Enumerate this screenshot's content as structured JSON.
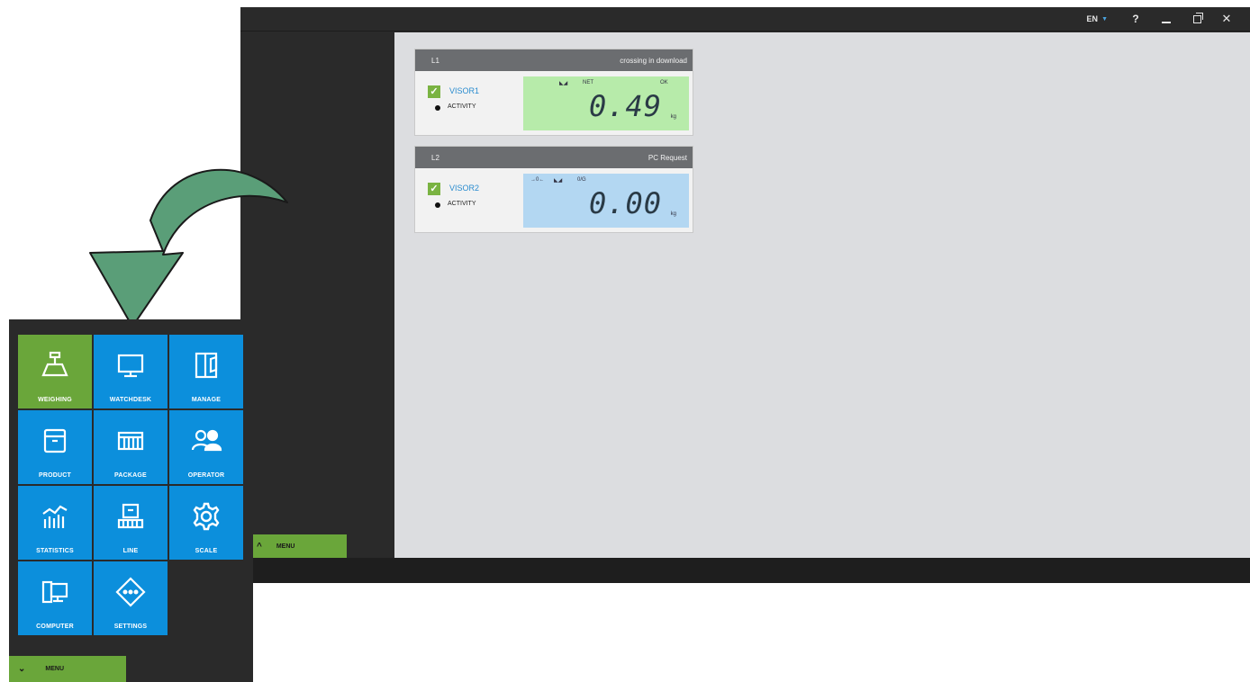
{
  "titlebar": {
    "language": "EN",
    "help": "?",
    "close": "✕"
  },
  "lines": [
    {
      "id": "L1",
      "status": "crossing in download",
      "visor": "VISOR1",
      "activity": "ACTIVITY",
      "value": "0.49",
      "unit": "kg",
      "flags": [
        "◣◢",
        "NET",
        "OK"
      ],
      "display_color": "#b7ebaa"
    },
    {
      "id": "L2",
      "status": "PC Request",
      "visor": "VISOR2",
      "activity": "ACTIVITY",
      "value": "0.00",
      "unit": "kg",
      "flags": [
        "→0←",
        "◣◢",
        "0/G"
      ],
      "display_color": "#b3d7f2"
    }
  ],
  "menu_button": {
    "label": "MENU"
  },
  "menu": {
    "tiles": [
      {
        "label": "WEIGHING",
        "icon": "scale-icon",
        "active": true
      },
      {
        "label": "WATCHDESK",
        "icon": "monitor-icon"
      },
      {
        "label": "MANAGE",
        "icon": "folder-icon"
      },
      {
        "label": "PRODUCT",
        "icon": "box-icon"
      },
      {
        "label": "PACKAGE",
        "icon": "package-icon"
      },
      {
        "label": "OPERATOR",
        "icon": "operators-icon"
      },
      {
        "label": "STATISTICS",
        "icon": "statistics-icon"
      },
      {
        "label": "LINE",
        "icon": "line-icon"
      },
      {
        "label": "SCALE",
        "icon": "gear-icon"
      },
      {
        "label": "COMPUTER",
        "icon": "computer-icon"
      },
      {
        "label": "SETTINGS",
        "icon": "settings-icon"
      }
    ],
    "toggle_label": "MENU"
  },
  "colors": {
    "tile_blue": "#0c8fdc",
    "tile_active": "#6aa63a",
    "arrow": "#5a9e78"
  }
}
